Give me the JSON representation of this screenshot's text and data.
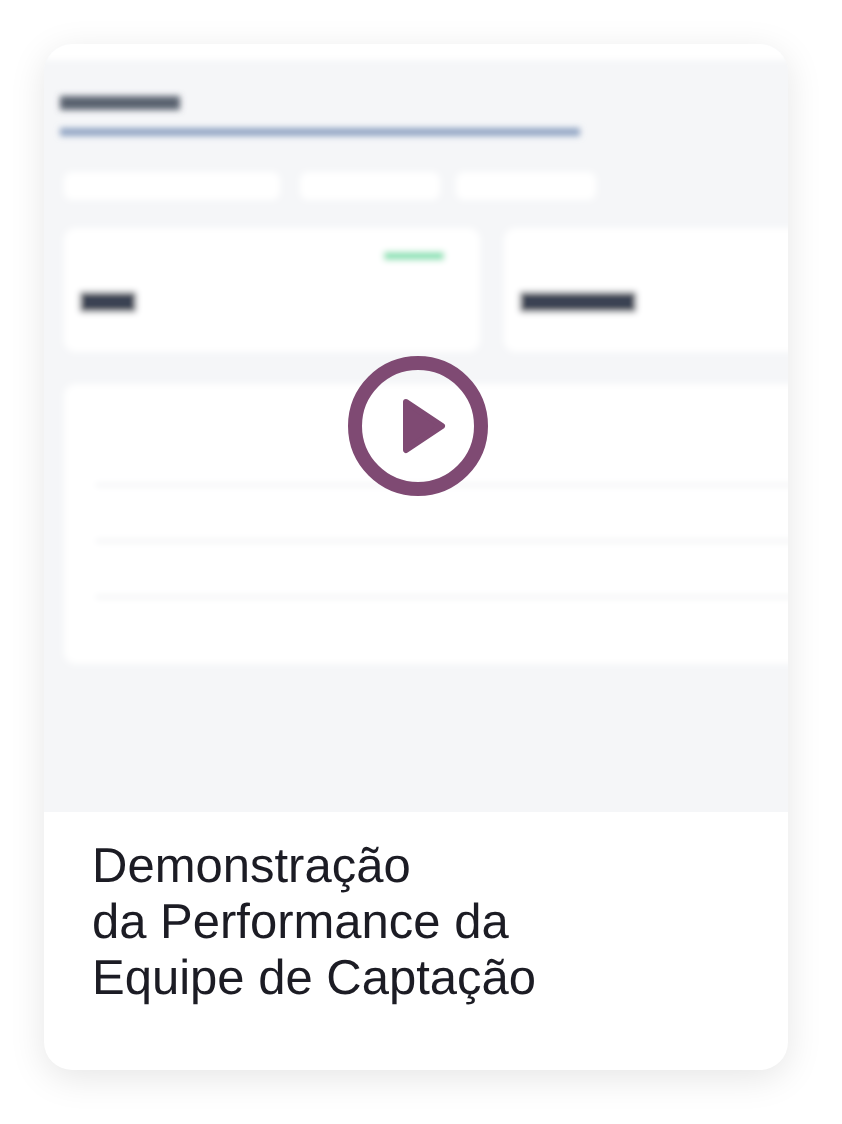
{
  "caption": "Demonstração\nda Performance da\nEquipe de Captação"
}
